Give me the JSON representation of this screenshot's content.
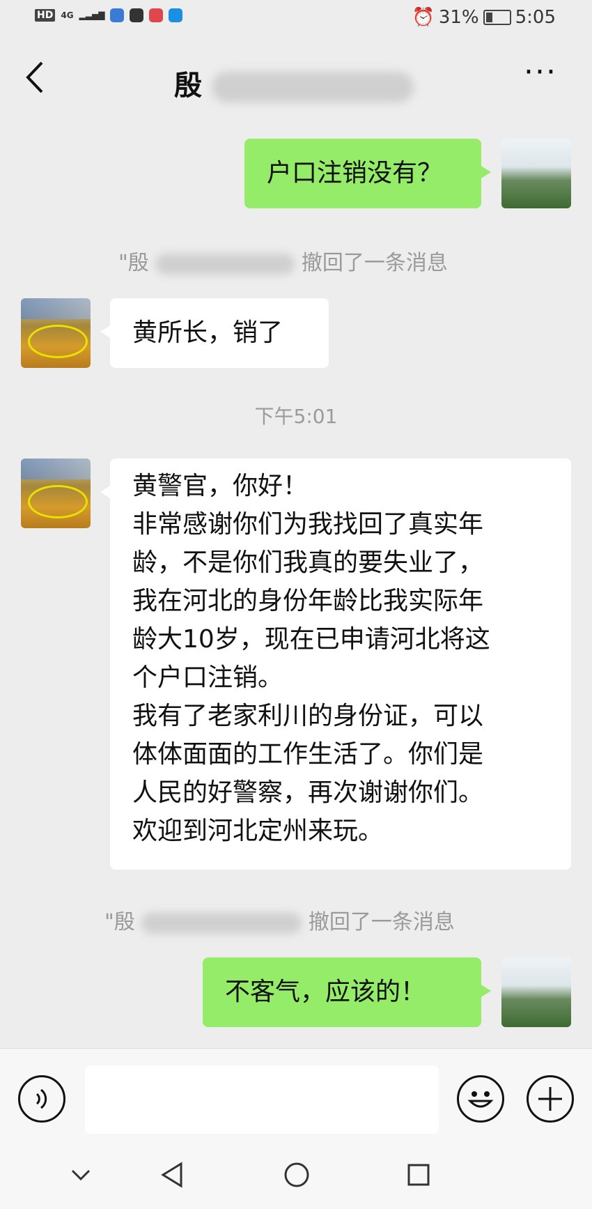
{
  "status": {
    "left_label": "HD",
    "signal": "4G",
    "battery_percent": "31%",
    "time": "5:05"
  },
  "header": {
    "title_visible": "殷",
    "back_icon": "chevron-left-icon",
    "more_icon": "more-dots-icon",
    "more_label": "···"
  },
  "messages": [
    {
      "from": "me",
      "text": "户口注销没有？"
    },
    {
      "from": "system",
      "prefix": "\"殷",
      "suffix": "撤回了一条消息"
    },
    {
      "from": "other",
      "text": "黄所长，销了"
    },
    {
      "from": "time",
      "text": "下午5:01"
    },
    {
      "from": "other",
      "text": "黄警官，你好！\n非常感谢你们为我找回了真实年\n龄，不是你们我真的要失业了，\n我在河北的身份年龄比我实际年\n龄大10岁，现在已申请河北将这\n个户口注销。\n我有了老家利川的身份证，可以\n体体面面的工作生活了。你们是\n人民的好警察，再次谢谢你们。\n欢迎到河北定州来玩。"
    },
    {
      "from": "system",
      "prefix": "\"殷",
      "suffix": "撤回了一条消息"
    },
    {
      "from": "me",
      "text": "不客气，应该的！"
    }
  ],
  "inputbar": {
    "voice_icon": "voice-icon",
    "emoji_icon": "emoji-icon",
    "plus_icon": "plus-icon",
    "input_value": ""
  },
  "navbar": {
    "icons": [
      "chevron-down-icon",
      "back-triangle-icon",
      "home-circle-icon",
      "recents-square-icon"
    ]
  },
  "colors": {
    "background": "#ededed",
    "my_bubble": "#95ec69",
    "other_bubble": "#ffffff",
    "system_text": "#9a9a9a"
  }
}
